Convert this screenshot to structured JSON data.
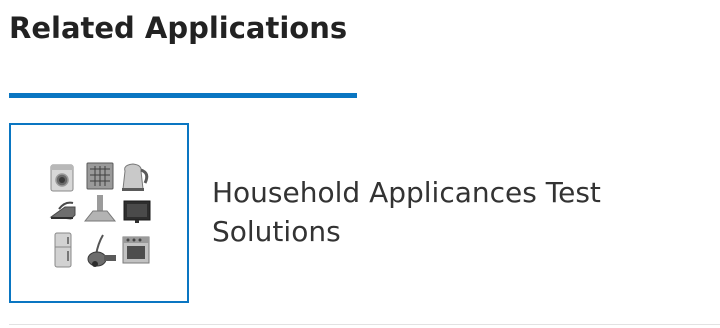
{
  "section": {
    "title": "Related Applications",
    "accent_color": "#0a76c2"
  },
  "applications": [
    {
      "title": "Household Applicances Test Solutions",
      "thumbnail_icon": "household-appliances-icon"
    }
  ]
}
